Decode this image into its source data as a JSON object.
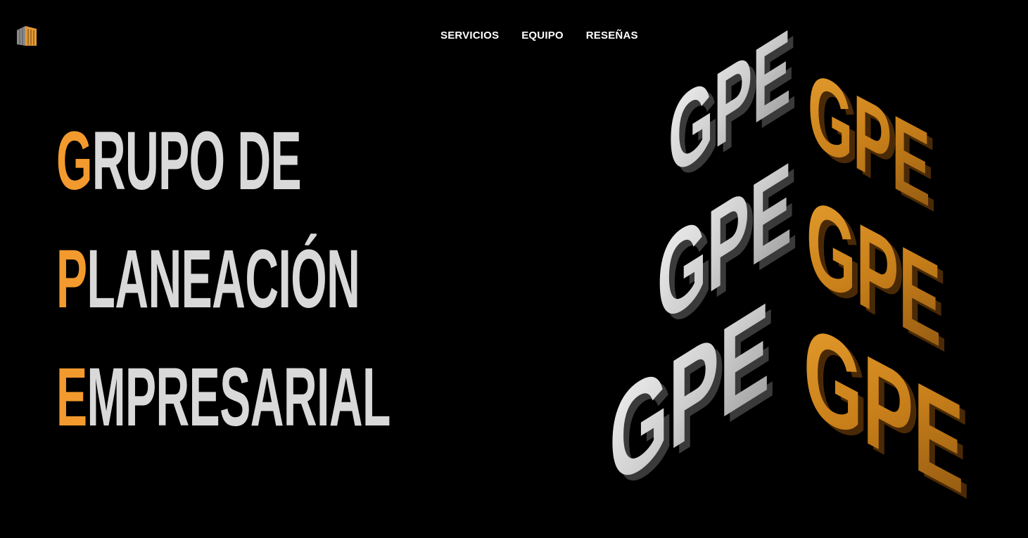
{
  "nav": {
    "items": [
      "SERVICIOS",
      "EQUIPO",
      "RESEÑAS"
    ]
  },
  "hero": {
    "line1": {
      "initial": "G",
      "rest": "RUPO DE"
    },
    "line2": {
      "initial": "P",
      "rest": "LANEACIÓN"
    },
    "line3": {
      "initial": "E",
      "rest": "MPRESARIAL"
    }
  },
  "art": {
    "word": "GPE"
  },
  "colors": {
    "background": "#000000",
    "accent": "#f29a2e",
    "text": "#d9d9d9",
    "nav_text": "#ffffff",
    "art_silver": "#e4e4e4",
    "art_gold": "#d68a1e"
  },
  "icons": {
    "logo": "building-logo-icon"
  }
}
